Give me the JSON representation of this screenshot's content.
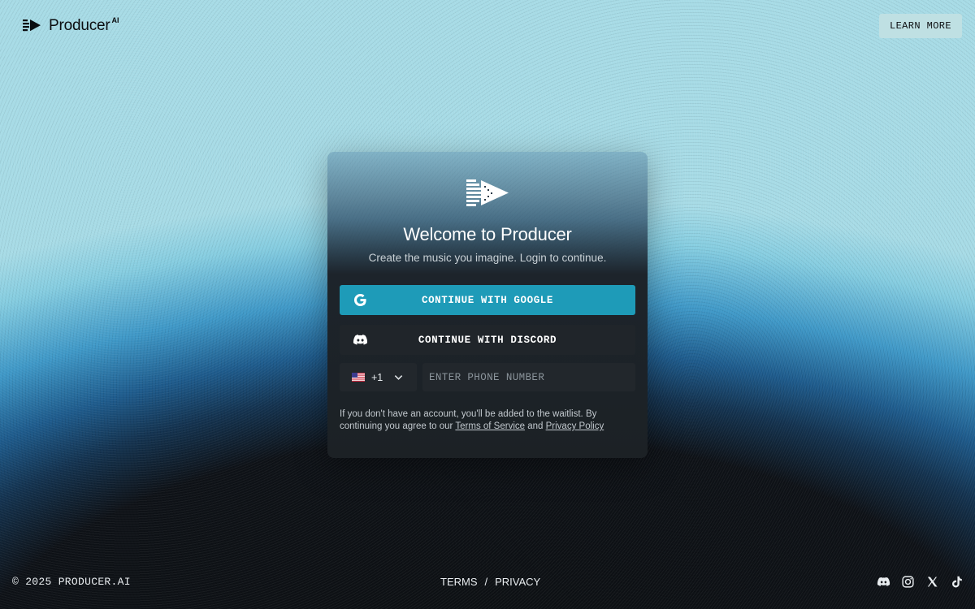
{
  "brand": {
    "name": "Producer",
    "superscript": "AI",
    "logo_icon": "producer-arrow-logo"
  },
  "header": {
    "learn_more": "LEARN MORE"
  },
  "card": {
    "title": "Welcome to Producer",
    "subtitle": "Create the music you imagine. Login to continue.",
    "google_button": "CONTINUE WITH GOOGLE",
    "discord_button": "CONTINUE WITH DISCORD",
    "phone": {
      "country_flag": "us-flag",
      "dial_code": "+1",
      "placeholder": "ENTER PHONE NUMBER"
    },
    "legal": {
      "prefix": "If you don't have an account, you'll be added to the waitlist. By continuing you agree to our",
      "terms": "Terms of Service",
      "and": "and",
      "privacy": "Privacy Policy"
    }
  },
  "footer": {
    "copyright": "© 2025 PRODUCER.AI",
    "terms": "TERMS",
    "separator": "/",
    "privacy": "PRIVACY",
    "socials": [
      "discord-icon",
      "instagram-icon",
      "x-icon",
      "tiktok-icon"
    ]
  },
  "colors": {
    "google_button": "#1e9bb8",
    "card_dark": "#1c2125",
    "learn_more_bg": "#bfe0e3"
  }
}
